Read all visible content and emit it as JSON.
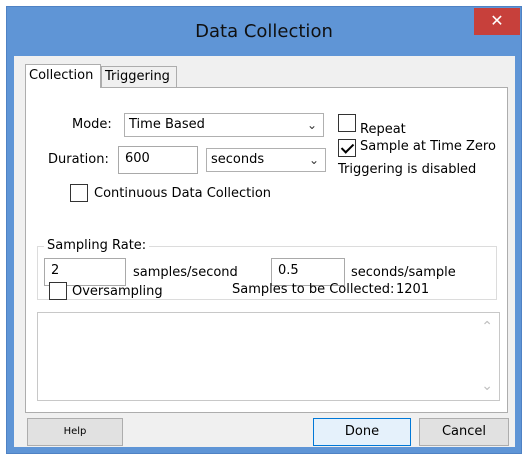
{
  "window": {
    "title": "Data Collection",
    "close_symbol": "✕"
  },
  "tabs": [
    {
      "label": "Collection",
      "active": true
    },
    {
      "label": "Triggering",
      "active": false
    }
  ],
  "mode": {
    "label": "Mode:",
    "value": "Time Based"
  },
  "duration": {
    "label": "Duration:",
    "value": "600",
    "unit": "seconds"
  },
  "options": {
    "repeat_label": "Repeat",
    "repeat_checked": false,
    "sample_zero_label": "Sample at Time Zero",
    "sample_zero_checked": true,
    "triggering_status": "Triggering is disabled",
    "continuous_label": "Continuous Data Collection",
    "continuous_checked": false
  },
  "sampling": {
    "title": "Sampling Rate:",
    "rate_value": "2",
    "rate_unit": "samples/second",
    "interval_value": "0.5",
    "interval_unit": "seconds/sample"
  },
  "oversampling": {
    "label": "Oversampling",
    "checked": false
  },
  "samples": {
    "label": "Samples to be Collected:",
    "count": "1201"
  },
  "buttons": {
    "help": "Help",
    "done": "Done",
    "cancel": "Cancel"
  },
  "icons": {
    "chevron": "⌄",
    "scroll_up": "⌃",
    "scroll_down": "⌄"
  },
  "colors": {
    "title_bar": "#5f95d6",
    "close_button": "#c7403b",
    "default_button_border": "#0078d7"
  }
}
